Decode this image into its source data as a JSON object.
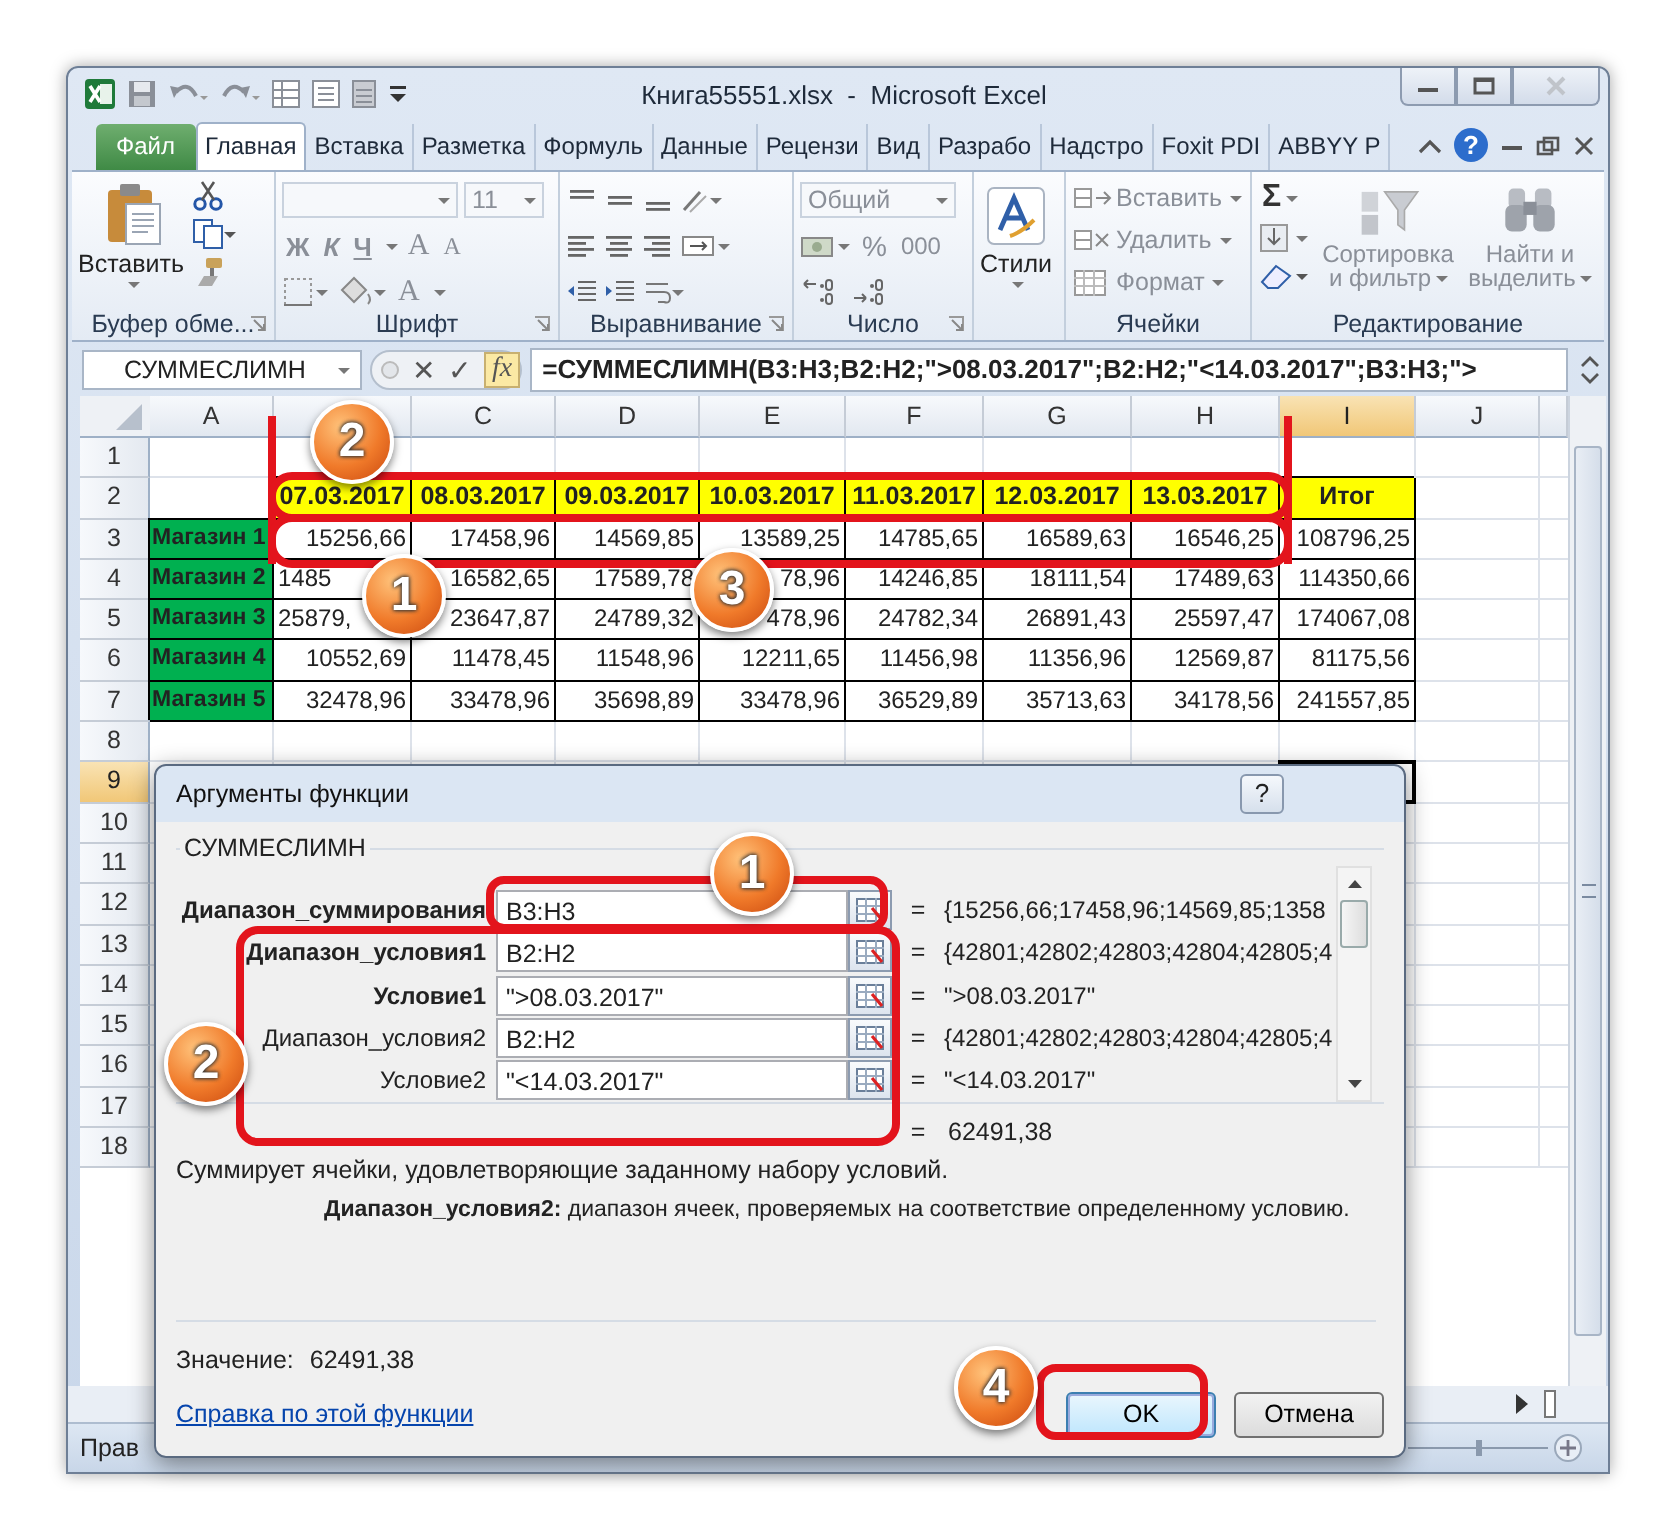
{
  "window": {
    "title": "Книга55551.xlsx  -  Microsoft Excel"
  },
  "ribbon_tabs": [
    {
      "label": "Файл",
      "kind": "file",
      "selected": false
    },
    {
      "label": "Главная",
      "kind": "tab",
      "selected": true
    },
    {
      "label": "Вставка",
      "kind": "tab",
      "selected": false
    },
    {
      "label": "Разметка",
      "kind": "tab",
      "selected": false
    },
    {
      "label": "Формуль",
      "kind": "tab",
      "selected": false
    },
    {
      "label": "Данные",
      "kind": "tab",
      "selected": false
    },
    {
      "label": "Рецензи",
      "kind": "tab",
      "selected": false
    },
    {
      "label": "Вид",
      "kind": "tab",
      "selected": false
    },
    {
      "label": "Разрабо",
      "kind": "tab",
      "selected": false
    },
    {
      "label": "Надстро",
      "kind": "tab",
      "selected": false
    },
    {
      "label": "Foxit PDI",
      "kind": "tab",
      "selected": false
    },
    {
      "label": "ABBYY P",
      "kind": "tab",
      "selected": false
    }
  ],
  "ribbon_help": "?",
  "ribbon": {
    "groups": [
      {
        "kind": "clipboard",
        "label": "Буфер обме...",
        "paste": "Вставить"
      },
      {
        "kind": "font",
        "label": "Шрифт",
        "size": "11",
        "bold": "Ж",
        "italic": "К",
        "underline": "Ч",
        "grow": "A",
        "shrink": "A",
        "font_color": "A"
      },
      {
        "kind": "alignment",
        "label": "Выравнивание"
      },
      {
        "kind": "number",
        "label": "Число",
        "format": "Общий",
        "percent": "%",
        "thousands": "000"
      },
      {
        "kind": "styles",
        "button": "Стили"
      },
      {
        "kind": "cells",
        "label": "Ячейки",
        "items": [
          "Вставить",
          "Удалить",
          "Формат"
        ]
      },
      {
        "kind": "editing",
        "label": "Редактирование",
        "sigma": "Σ",
        "sort": "Сортировка и фильтр",
        "find": "Найти и выделить"
      }
    ]
  },
  "formula_bar": {
    "name_box": "СУММЕСЛИМН",
    "cancel": "✕",
    "enter": "✓",
    "fx": "fx",
    "formula": "=СУММЕСЛИМН(B3:H3;B2:H2;\">08.03.2017\";B2:H2;\"<14.03.2017\";B3:H3;\">"
  },
  "sheet": {
    "columns": [
      {
        "label": "A",
        "selected": false
      },
      {
        "selected": false
      },
      {
        "label": "C",
        "selected": false
      },
      {
        "label": "D",
        "selected": false
      },
      {
        "label": "E",
        "selected": false
      },
      {
        "label": "F",
        "selected": false
      },
      {
        "label": "G",
        "selected": false
      },
      {
        "label": "H",
        "selected": false
      },
      {
        "label": "I",
        "selected": true
      },
      {
        "label": "J",
        "selected": false
      }
    ],
    "rows": [
      {
        "header": "1",
        "selected": false
      },
      {
        "header": "2",
        "selected": false,
        "cells": [
          {
            "kind": "empty"
          },
          {
            "kind": "date",
            "text": "07.03.2017"
          },
          {
            "kind": "date",
            "text": "08.03.2017"
          },
          {
            "kind": "date",
            "text": "09.03.2017"
          },
          {
            "kind": "date",
            "text": "10.03.2017"
          },
          {
            "kind": "date",
            "text": "11.03.2017"
          },
          {
            "kind": "date",
            "text": "12.03.2017"
          },
          {
            "kind": "date",
            "text": "13.03.2017"
          },
          {
            "kind": "total_head",
            "text": "Итог"
          }
        ]
      },
      {
        "header": "3",
        "selected": false,
        "cells": [
          {
            "kind": "store",
            "text": "Магазин 1"
          },
          {
            "kind": "number",
            "text": "15256,66"
          },
          {
            "kind": "number",
            "text": "17458,96"
          },
          {
            "kind": "number",
            "text": "14569,85"
          },
          {
            "kind": "number",
            "text": "13589,25"
          },
          {
            "kind": "number",
            "text": "14785,65"
          },
          {
            "kind": "number",
            "text": "16589,63"
          },
          {
            "kind": "number",
            "text": "16546,25"
          },
          {
            "kind": "number",
            "text": "108796,25"
          }
        ]
      },
      {
        "header": "4",
        "selected": false,
        "cells": [
          {
            "kind": "store",
            "text": "Магазин 2"
          },
          {
            "kind": "number",
            "text": "1485"
          },
          {
            "kind": "number",
            "text": "16582,65"
          },
          {
            "kind": "number",
            "text": "17589,78"
          },
          {
            "kind": "number",
            "text": "78,96"
          },
          {
            "kind": "number",
            "text": "14246,85"
          },
          {
            "kind": "number",
            "text": "18111,54"
          },
          {
            "kind": "number",
            "text": "17489,63"
          },
          {
            "kind": "number",
            "text": "114350,66"
          }
        ]
      },
      {
        "header": "5",
        "selected": false,
        "cells": [
          {
            "kind": "store",
            "text": "Магазин 3"
          },
          {
            "kind": "number",
            "text": "25879,"
          },
          {
            "kind": "number",
            "text": "23647,87"
          },
          {
            "kind": "number",
            "text": "24789,32"
          },
          {
            "kind": "number",
            "text": "478,96"
          },
          {
            "kind": "number",
            "text": "24782,34"
          },
          {
            "kind": "number",
            "text": "26891,43"
          },
          {
            "kind": "number",
            "text": "25597,47"
          },
          {
            "kind": "number",
            "text": "174067,08"
          }
        ]
      },
      {
        "header": "6",
        "selected": false,
        "cells": [
          {
            "kind": "store",
            "text": "Магазин 4"
          },
          {
            "kind": "number",
            "text": "10552,69"
          },
          {
            "kind": "number",
            "text": "11478,45"
          },
          {
            "kind": "number",
            "text": "11548,96"
          },
          {
            "kind": "number",
            "text": "12211,65"
          },
          {
            "kind": "number",
            "text": "11456,98"
          },
          {
            "kind": "number",
            "text": "11356,96"
          },
          {
            "kind": "number",
            "text": "12569,87"
          },
          {
            "kind": "number",
            "text": "81175,56"
          }
        ]
      },
      {
        "header": "7",
        "selected": false,
        "cells": [
          {
            "kind": "store",
            "text": "Магазин 5"
          },
          {
            "kind": "number",
            "text": "32478,96"
          },
          {
            "kind": "number",
            "text": "33478,96"
          },
          {
            "kind": "number",
            "text": "35698,89"
          },
          {
            "kind": "number",
            "text": "33478,96"
          },
          {
            "kind": "number",
            "text": "36529,89"
          },
          {
            "kind": "number",
            "text": "35713,63"
          },
          {
            "kind": "number",
            "text": "34178,56"
          },
          {
            "kind": "number",
            "text": "241557,85"
          }
        ]
      },
      {
        "header": "8",
        "selected": false
      },
      {
        "header": "9",
        "selected": true
      },
      {
        "header": "10",
        "selected": false
      },
      {
        "header": "11",
        "selected": false
      },
      {
        "header": "12",
        "selected": false
      },
      {
        "header": "13",
        "selected": false
      },
      {
        "header": "14",
        "selected": false
      },
      {
        "header": "15",
        "selected": false
      },
      {
        "header": "16",
        "selected": false
      },
      {
        "header": "17",
        "selected": false
      },
      {
        "header": "18",
        "selected": false
      }
    ]
  },
  "dialog": {
    "title": "Аргументы функции",
    "help": "?",
    "function": "СУММЕСЛИМН",
    "arguments": [
      {
        "label": "Диапазон_суммирования",
        "required": true,
        "value": "B3:H3",
        "equals": "=",
        "result": "{15256,66;17458,96;14569,85;1358"
      },
      {
        "label": "Диапазон_условия1",
        "required": true,
        "value": "B2:H2",
        "equals": "=",
        "result": "{42801;42802;42803;42804;42805;4"
      },
      {
        "label": "Условие1",
        "required": true,
        "value": "\">08.03.2017\"",
        "equals": "=",
        "result": "\">08.03.2017\""
      },
      {
        "label": "Диапазон_условия2",
        "required": false,
        "value": "B2:H2",
        "equals": "=",
        "result": "{42801;42802;42803;42804;42805;4"
      },
      {
        "label": "Условие2",
        "required": false,
        "value": "\"<14.03.2017\"",
        "equals": "=",
        "result": "\"<14.03.2017\""
      }
    ],
    "result_equals": "=",
    "result": "62491,38",
    "description": "Суммирует ячейки, удовлетворяющие заданному набору условий.",
    "argument_help": "**Диапазон_условия2:**  диапазон ячеек, проверяемых на соответствие определенному условию.",
    "value_label": "Значение:",
    "value": "62491,38",
    "help_link": "Справка по этой функции",
    "buttons": [
      {
        "label": "OK",
        "default": true
      },
      {
        "label": "Отмена",
        "default": false
      }
    ]
  },
  "callouts": [
    "2",
    "1",
    "3",
    "1",
    "2",
    "4"
  ],
  "status_bar": {
    "text": "Прав"
  }
}
